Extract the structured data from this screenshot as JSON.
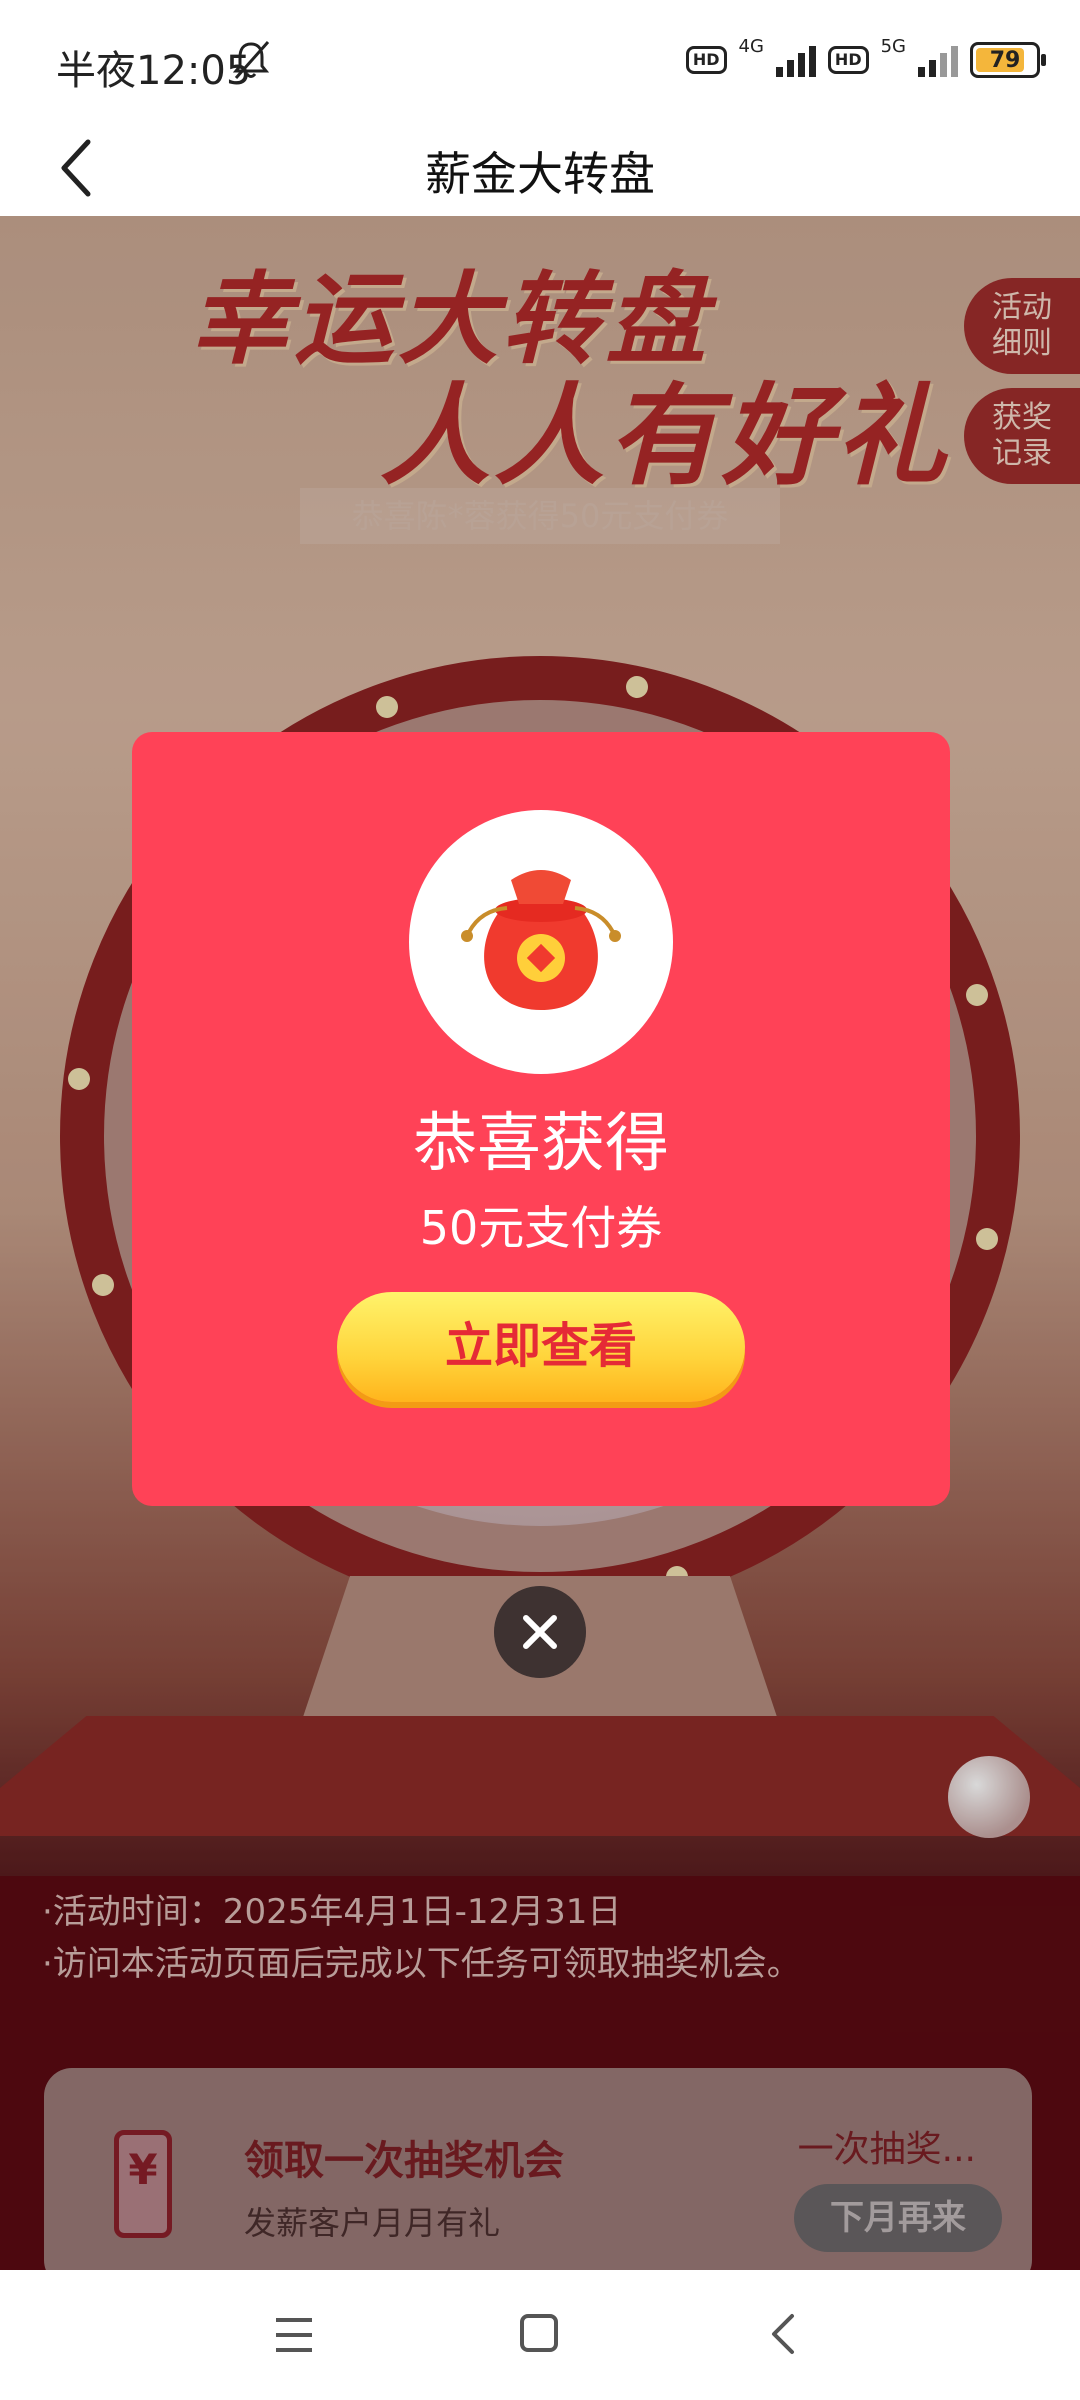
{
  "status_bar": {
    "time": "半夜12:05",
    "net1": "4G",
    "net2": "5G",
    "hd": "HD",
    "battery": "79"
  },
  "header": {
    "title": "薪金大转盘"
  },
  "stage": {
    "headline_line1": "幸运大转盘",
    "headline_line2": "人人有好礼",
    "ticker": "恭喜陈*蓉获得50元支付券",
    "rules_button": "活动\n细则",
    "records_button": "获奖\n记录"
  },
  "info": {
    "line1": "·活动时间：2025年4月1日-12月31日",
    "line2": "·访问本活动页面后完成以下任务可领取抽奖机会。"
  },
  "task": {
    "title": "领取一次抽奖机会",
    "subtitle": "发薪客户月月有礼",
    "limit": "一次抽奖...",
    "button": "下月再来"
  },
  "modal": {
    "title": "恭喜获得",
    "prize": "50元支付券",
    "button": "立即查看"
  },
  "colors": {
    "modal_bg": "#ff4257",
    "button_yellow": "#ffd43b",
    "accent_red": "#e52a36"
  }
}
